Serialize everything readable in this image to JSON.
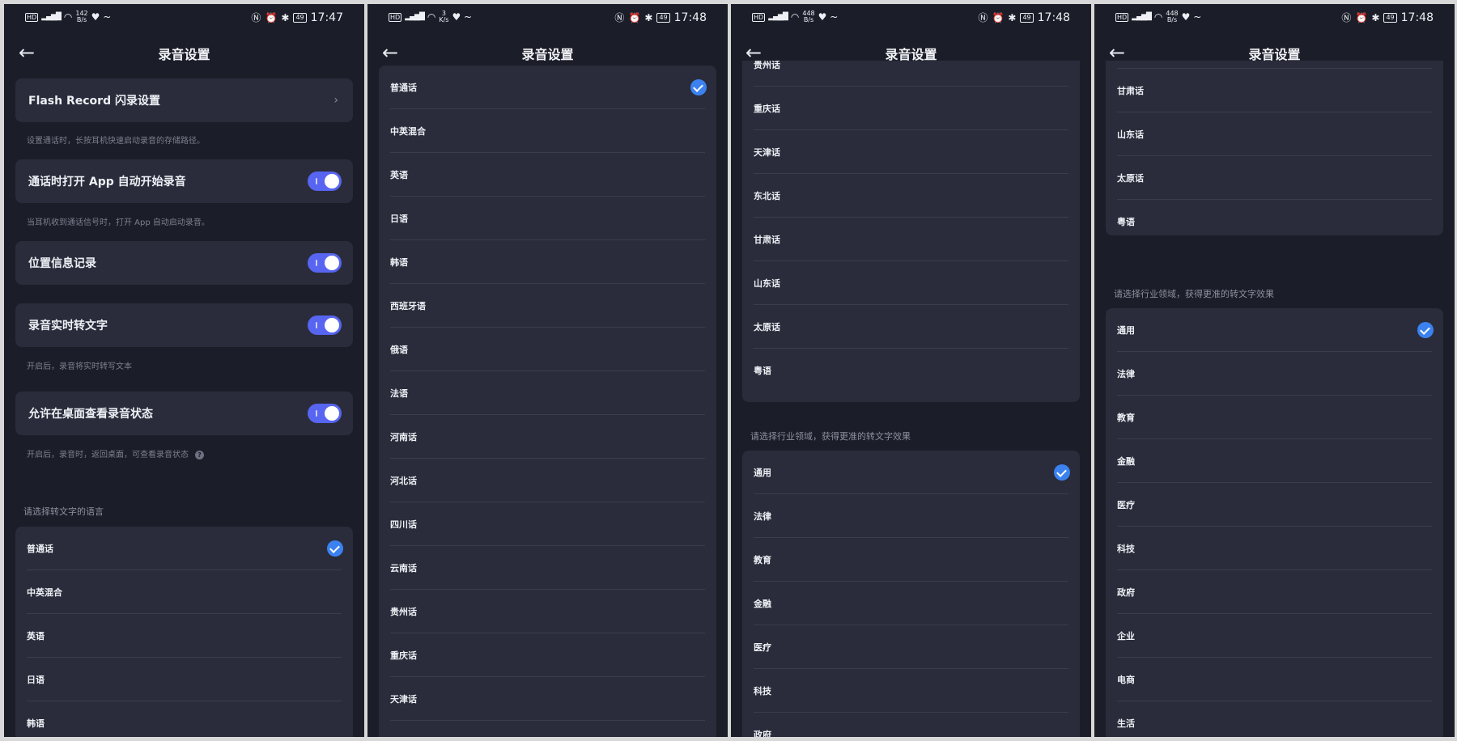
{
  "status_bars": [
    {
      "speed_top": "142",
      "speed_unit": "B/s",
      "time": "17:47",
      "battery": "49"
    },
    {
      "speed_top": "3",
      "speed_unit": "K/s",
      "time": "17:48",
      "battery": "49"
    },
    {
      "speed_top": "448",
      "speed_unit": "B/s",
      "time": "17:48",
      "battery": "49"
    },
    {
      "speed_top": "448",
      "speed_unit": "B/s",
      "time": "17:48",
      "battery": "49"
    }
  ],
  "status_common": {
    "hd": "HD",
    "signal": "5G",
    "glyphs": "♥ ~"
  },
  "header": {
    "title": "录音设置"
  },
  "settings": {
    "flash_record": "Flash Record 闪录设置",
    "flash_record_hint": "设置通话时，长按耳机快速启动录音的存储路径。",
    "auto_record": "通话时打开 App 自动开始录音",
    "auto_record_hint": "当耳机收到通话信号时，打开 App 自动启动录音。",
    "location": "位置信息记录",
    "realtime": "录音实时转文字",
    "realtime_hint": "开启后，录音将实时转写文本",
    "desktop": "允许在桌面查看录音状态",
    "desktop_hint": "开启后，录音时，返回桌面，可查看录音状态",
    "language_section": "请选择转文字的语言",
    "industry_section": "请选择行业领域，获得更准的转文字效果"
  },
  "languages": [
    "普通话",
    "中英混合",
    "英语",
    "日语",
    "韩语",
    "西班牙语",
    "俄语",
    "法语",
    "河南话",
    "河北话",
    "四川话",
    "云南话",
    "贵州话",
    "重庆话",
    "天津话",
    "东北话",
    "甘肃话",
    "山东话",
    "太原话",
    "粤语"
  ],
  "industries": [
    "通用",
    "法律",
    "教育",
    "金融",
    "医疗",
    "科技",
    "政府",
    "企业",
    "电商",
    "生活"
  ],
  "colors": {
    "background": "#1b1d28",
    "card": "#2a2c3b",
    "toggle": "#5765f0",
    "check": "#3b82f0"
  }
}
